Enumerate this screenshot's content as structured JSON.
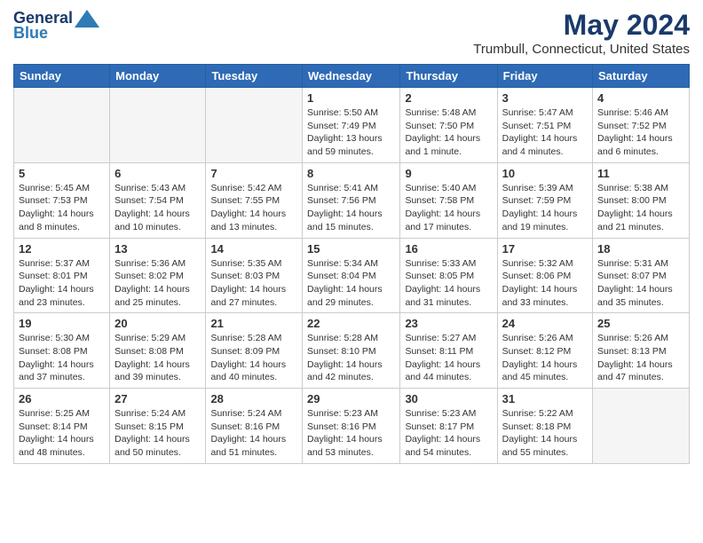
{
  "header": {
    "logo_general": "General",
    "logo_blue": "Blue",
    "main_title": "May 2024",
    "subtitle": "Trumbull, Connecticut, United States"
  },
  "days_of_week": [
    "Sunday",
    "Monday",
    "Tuesday",
    "Wednesday",
    "Thursday",
    "Friday",
    "Saturday"
  ],
  "weeks": [
    {
      "days": [
        {
          "num": "",
          "info": ""
        },
        {
          "num": "",
          "info": ""
        },
        {
          "num": "",
          "info": ""
        },
        {
          "num": "1",
          "info": "Sunrise: 5:50 AM\nSunset: 7:49 PM\nDaylight: 13 hours and 59 minutes."
        },
        {
          "num": "2",
          "info": "Sunrise: 5:48 AM\nSunset: 7:50 PM\nDaylight: 14 hours and 1 minute."
        },
        {
          "num": "3",
          "info": "Sunrise: 5:47 AM\nSunset: 7:51 PM\nDaylight: 14 hours and 4 minutes."
        },
        {
          "num": "4",
          "info": "Sunrise: 5:46 AM\nSunset: 7:52 PM\nDaylight: 14 hours and 6 minutes."
        }
      ]
    },
    {
      "days": [
        {
          "num": "5",
          "info": "Sunrise: 5:45 AM\nSunset: 7:53 PM\nDaylight: 14 hours and 8 minutes."
        },
        {
          "num": "6",
          "info": "Sunrise: 5:43 AM\nSunset: 7:54 PM\nDaylight: 14 hours and 10 minutes."
        },
        {
          "num": "7",
          "info": "Sunrise: 5:42 AM\nSunset: 7:55 PM\nDaylight: 14 hours and 13 minutes."
        },
        {
          "num": "8",
          "info": "Sunrise: 5:41 AM\nSunset: 7:56 PM\nDaylight: 14 hours and 15 minutes."
        },
        {
          "num": "9",
          "info": "Sunrise: 5:40 AM\nSunset: 7:58 PM\nDaylight: 14 hours and 17 minutes."
        },
        {
          "num": "10",
          "info": "Sunrise: 5:39 AM\nSunset: 7:59 PM\nDaylight: 14 hours and 19 minutes."
        },
        {
          "num": "11",
          "info": "Sunrise: 5:38 AM\nSunset: 8:00 PM\nDaylight: 14 hours and 21 minutes."
        }
      ]
    },
    {
      "days": [
        {
          "num": "12",
          "info": "Sunrise: 5:37 AM\nSunset: 8:01 PM\nDaylight: 14 hours and 23 minutes."
        },
        {
          "num": "13",
          "info": "Sunrise: 5:36 AM\nSunset: 8:02 PM\nDaylight: 14 hours and 25 minutes."
        },
        {
          "num": "14",
          "info": "Sunrise: 5:35 AM\nSunset: 8:03 PM\nDaylight: 14 hours and 27 minutes."
        },
        {
          "num": "15",
          "info": "Sunrise: 5:34 AM\nSunset: 8:04 PM\nDaylight: 14 hours and 29 minutes."
        },
        {
          "num": "16",
          "info": "Sunrise: 5:33 AM\nSunset: 8:05 PM\nDaylight: 14 hours and 31 minutes."
        },
        {
          "num": "17",
          "info": "Sunrise: 5:32 AM\nSunset: 8:06 PM\nDaylight: 14 hours and 33 minutes."
        },
        {
          "num": "18",
          "info": "Sunrise: 5:31 AM\nSunset: 8:07 PM\nDaylight: 14 hours and 35 minutes."
        }
      ]
    },
    {
      "days": [
        {
          "num": "19",
          "info": "Sunrise: 5:30 AM\nSunset: 8:08 PM\nDaylight: 14 hours and 37 minutes."
        },
        {
          "num": "20",
          "info": "Sunrise: 5:29 AM\nSunset: 8:08 PM\nDaylight: 14 hours and 39 minutes."
        },
        {
          "num": "21",
          "info": "Sunrise: 5:28 AM\nSunset: 8:09 PM\nDaylight: 14 hours and 40 minutes."
        },
        {
          "num": "22",
          "info": "Sunrise: 5:28 AM\nSunset: 8:10 PM\nDaylight: 14 hours and 42 minutes."
        },
        {
          "num": "23",
          "info": "Sunrise: 5:27 AM\nSunset: 8:11 PM\nDaylight: 14 hours and 44 minutes."
        },
        {
          "num": "24",
          "info": "Sunrise: 5:26 AM\nSunset: 8:12 PM\nDaylight: 14 hours and 45 minutes."
        },
        {
          "num": "25",
          "info": "Sunrise: 5:26 AM\nSunset: 8:13 PM\nDaylight: 14 hours and 47 minutes."
        }
      ]
    },
    {
      "days": [
        {
          "num": "26",
          "info": "Sunrise: 5:25 AM\nSunset: 8:14 PM\nDaylight: 14 hours and 48 minutes."
        },
        {
          "num": "27",
          "info": "Sunrise: 5:24 AM\nSunset: 8:15 PM\nDaylight: 14 hours and 50 minutes."
        },
        {
          "num": "28",
          "info": "Sunrise: 5:24 AM\nSunset: 8:16 PM\nDaylight: 14 hours and 51 minutes."
        },
        {
          "num": "29",
          "info": "Sunrise: 5:23 AM\nSunset: 8:16 PM\nDaylight: 14 hours and 53 minutes."
        },
        {
          "num": "30",
          "info": "Sunrise: 5:23 AM\nSunset: 8:17 PM\nDaylight: 14 hours and 54 minutes."
        },
        {
          "num": "31",
          "info": "Sunrise: 5:22 AM\nSunset: 8:18 PM\nDaylight: 14 hours and 55 minutes."
        },
        {
          "num": "",
          "info": ""
        }
      ]
    }
  ]
}
